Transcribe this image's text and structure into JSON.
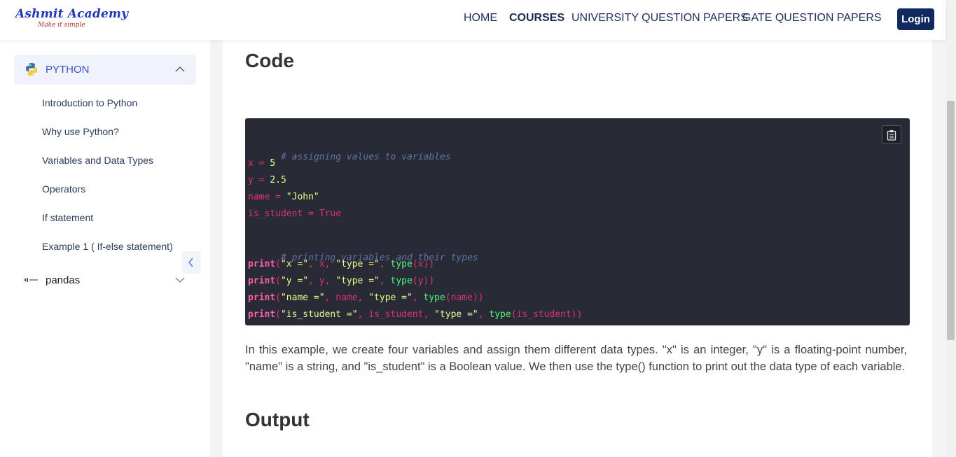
{
  "brand": {
    "title": "Ashmit Academy",
    "tagline": "Make it simple"
  },
  "nav": {
    "home": "HOME",
    "courses": "COURSES",
    "university": "UNIVERSITY QUESTION PAPERS",
    "gate": "GATE QUESTION PAPERS",
    "login": "Login"
  },
  "sidebar": {
    "python": {
      "label": "PYTHON",
      "items": [
        "Introduction to Python",
        "Why use Python?",
        "Variables and Data Types",
        "Operators",
        "If statement",
        "Example 1 ( If-else statement)"
      ]
    },
    "pandas": {
      "label": "pandas"
    }
  },
  "content": {
    "code_heading": "Code",
    "output_heading": "Output",
    "paragraph": "In this example, we create four variables and assign them different data types. \"x\" is an integer, \"y\" is a floating-point number, \"name\" is a string, and \"is_student\" is a Boolean value. We then use the type() function to print out the data type of each variable.",
    "code": {
      "comment1": "# assigning values to variables",
      "x_var": "x",
      "x_eq": " = ",
      "x_val": "5",
      "y_var": "y",
      "y_eq": " = ",
      "y_val": "2.5",
      "name_var": "name",
      "name_eq": " = ",
      "name_val": "\"John\"",
      "stu_var": "is_student",
      "stu_eq": " = ",
      "stu_val": "True",
      "comment2": "# printing variables and their types",
      "print": "print",
      "p1": {
        "open": "(",
        "s1": "\"x =\"",
        "mid1": ", x, ",
        "s2": "\"type =\"",
        "mid2": ", ",
        "fn": "type",
        "arg": "(x))"
      },
      "p2": {
        "open": "(",
        "s1": "\"y =\"",
        "mid1": ", y, ",
        "s2": "\"type =\"",
        "mid2": ", ",
        "fn": "type",
        "arg": "(y))"
      },
      "p3": {
        "open": "(",
        "s1": "\"name =\"",
        "mid1": ", name, ",
        "s2": "\"type =\"",
        "mid2": ", ",
        "fn": "type",
        "arg": "(name))"
      },
      "p4": {
        "open": "(",
        "s1": "\"is_student =\"",
        "mid1": ", is_student, ",
        "s2": "\"type =\"",
        "mid2": ", ",
        "fn": "type",
        "arg": "(is_student))"
      }
    }
  },
  "icons": {
    "python": "python-logo-icon",
    "chevron_up": "chevron-up-icon",
    "chevron_down": "chevron-down-icon",
    "chevron_left": "chevron-left-icon",
    "copy": "clipboard-icon",
    "pandas": "pandas-logo-icon"
  },
  "colors": {
    "brand_blue": "#2437b8",
    "login_bg": "#10295e",
    "code_bg": "#282a36",
    "active_section": "#3b4fc4"
  }
}
